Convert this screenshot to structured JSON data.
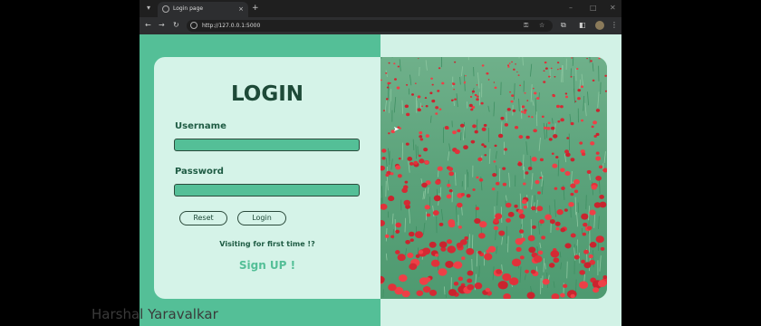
{
  "browser": {
    "tab_menu_icon": "chevron-down-icon",
    "tab_title": "Login page",
    "tab_close": "×",
    "new_tab": "+",
    "window_controls": [
      "–",
      "□",
      "✕"
    ],
    "url": "http://127.0.0.1:5000"
  },
  "login": {
    "title": "LOGIN",
    "username_label": "Username",
    "username_value": "",
    "password_label": "Password",
    "password_value": "",
    "reset_label": "Reset",
    "login_label": "Login",
    "first_time_text": "Visiting for first time !?",
    "signup_label": "Sign UP !"
  },
  "colors": {
    "accent": "#54bf97",
    "card": "#d5f3e8",
    "text_dark": "#1e4a38"
  },
  "image": {
    "subject": "poppy-field"
  },
  "watermark": "Harshal Yaravalkar"
}
